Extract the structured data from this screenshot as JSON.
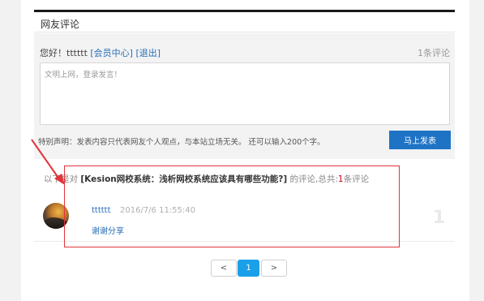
{
  "section": {
    "title": "网友评论"
  },
  "form": {
    "greeting_prefix": "您好！tttttt",
    "member_center_link": "[会员中心]",
    "logout_link": "[退出]",
    "comment_count": "1条评论",
    "textarea_placeholder": "文明上网，登录发言！",
    "disclaimer": "特别声明：发表内容只代表网友个人观点，与本站立场无关。 还可以输入200个字。",
    "submit_label": "马上发表"
  },
  "list": {
    "intro_prefix": "以下是对",
    "article_title": "[Kesion网校系统：浅析网校系统应该具有哪些功能?]",
    "intro_middle": "的评论,总共:",
    "total_count": "1",
    "intro_suffix": "条评论"
  },
  "comments": [
    {
      "user": "tttttt",
      "time": "2016/7/6 11:55:40",
      "body": "谢谢分享",
      "floor": "1"
    }
  ],
  "pagination": {
    "prev": "<",
    "current": "1",
    "next": ">"
  },
  "colors": {
    "accent": "#1e73c5",
    "link": "#2a6db5",
    "annotation": "#e0353b",
    "page_active": "#1aa0e8"
  }
}
